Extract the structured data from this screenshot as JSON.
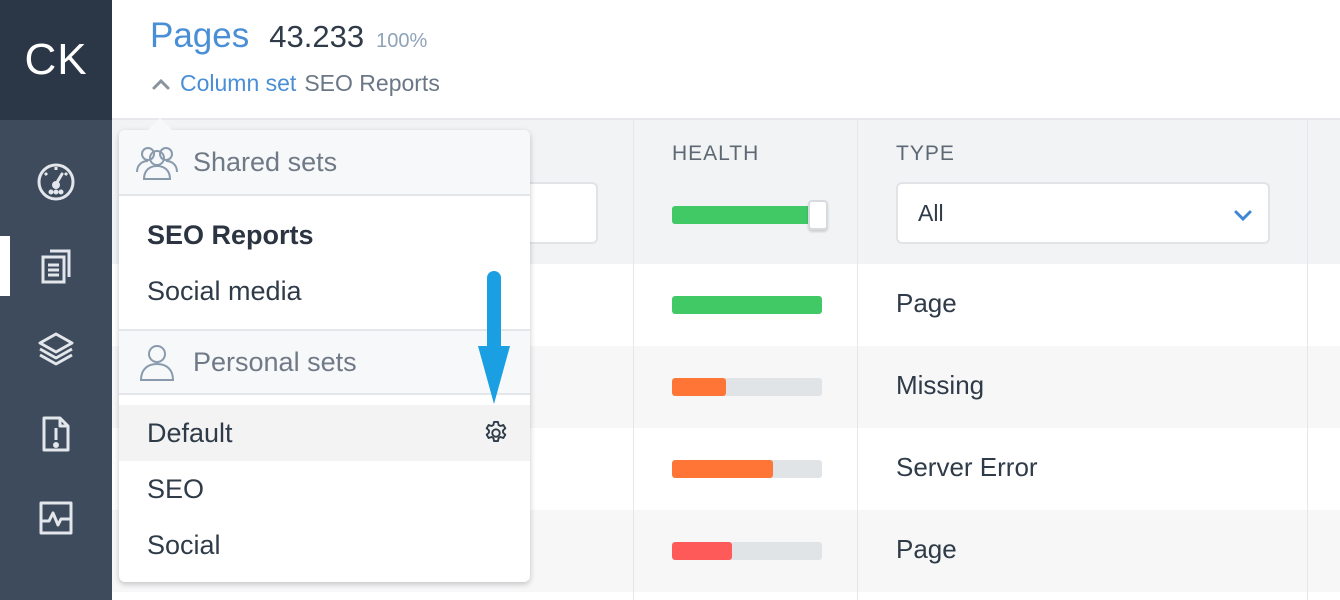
{
  "app": {
    "logo": "CK"
  },
  "sidebar": {
    "items": [
      {
        "id": "dashboard",
        "icon": "speedometer-icon",
        "active": false
      },
      {
        "id": "pages",
        "icon": "documents-icon",
        "active": true
      },
      {
        "id": "layers",
        "icon": "layers-icon",
        "active": false
      },
      {
        "id": "issues",
        "icon": "file-alert-icon",
        "active": false
      },
      {
        "id": "monitoring",
        "icon": "pulse-chart-icon",
        "active": false
      }
    ]
  },
  "header": {
    "title": "Pages",
    "count": "43.233",
    "percent": "100%",
    "column_set_label": "Column set",
    "column_set_value": "SEO Reports"
  },
  "table": {
    "columns": {
      "health": "HEALTH",
      "type": "TYPE"
    },
    "filters": {
      "health_slider_value": 1.0,
      "type_selected": "All"
    },
    "rows": [
      {
        "health": 1.0,
        "health_color": "#40c965",
        "type": "Page"
      },
      {
        "health": 0.36,
        "health_color": "#ff7535",
        "type": "Missing"
      },
      {
        "health": 0.67,
        "health_color": "#ff7535",
        "type": "Server Error"
      },
      {
        "health": 0.4,
        "health_color": "#ff5a5a",
        "type": "Page"
      }
    ]
  },
  "dropdown": {
    "shared_title": "Shared sets",
    "shared_items": [
      {
        "label": "SEO Reports",
        "selected": true
      },
      {
        "label": "Social media",
        "selected": false
      }
    ],
    "personal_title": "Personal sets",
    "personal_items": [
      {
        "label": "Default",
        "hovered": true,
        "has_settings": true
      },
      {
        "label": "SEO",
        "hovered": false
      },
      {
        "label": "Social",
        "hovered": false
      }
    ]
  },
  "colors": {
    "accent": "#4a8fd6",
    "sidebar": "#3d4b5c",
    "logo_bg": "#2b3746",
    "annotation_arrow": "#1a9fe3"
  }
}
